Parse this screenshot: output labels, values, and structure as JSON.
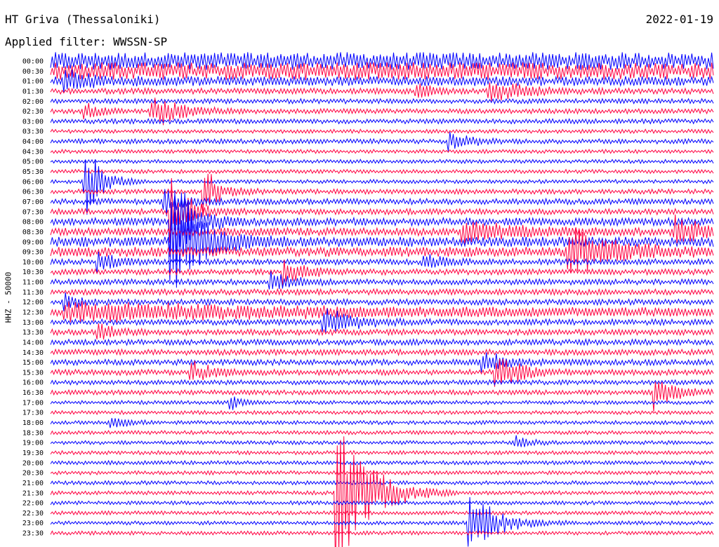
{
  "header": {
    "station": "HT Griva (Thessaloniki)",
    "date": "2022-01-19",
    "filter": "Applied filter: WWSSN-SP"
  },
  "chart_data": {
    "type": "line",
    "title": "HT Griva (Thessaloniki)",
    "ylabel": "HHZ - 50000",
    "row_labels": [
      "00:00",
      "00:30",
      "01:00",
      "01:30",
      "02:00",
      "02:30",
      "03:00",
      "03:30",
      "04:00",
      "04:30",
      "05:00",
      "05:30",
      "06:00",
      "06:30",
      "07:00",
      "07:30",
      "08:00",
      "08:30",
      "09:00",
      "09:30",
      "10:00",
      "10:30",
      "11:00",
      "11:30",
      "12:00",
      "12:30",
      "13:00",
      "13:30",
      "14:00",
      "14:30",
      "15:00",
      "15:30",
      "16:00",
      "16:30",
      "17:00",
      "17:30",
      "18:00",
      "18:30",
      "19:00",
      "19:30",
      "20:00",
      "20:30",
      "21:00",
      "21:30",
      "22:00",
      "22:30",
      "23:00",
      "23:30"
    ],
    "row_colors": [
      "#0000ff",
      "#ff0040"
    ],
    "baseline_noise": [
      9,
      9,
      5,
      3,
      2.5,
      2.5,
      2.5,
      2,
      2.5,
      2,
      2,
      2,
      2,
      2.5,
      3,
      3,
      4,
      4,
      5,
      5,
      3,
      3,
      3,
      3,
      3,
      4,
      3,
      3,
      3,
      3,
      3,
      3,
      2.5,
      2.5,
      2,
      2,
      2,
      2,
      2,
      2,
      2,
      2,
      2,
      2,
      2,
      2,
      2,
      2
    ],
    "events": [
      {
        "row": 2,
        "x": 0.02,
        "amp": 14,
        "dur": 0.04
      },
      {
        "row": 3,
        "x": 0.55,
        "amp": 12,
        "dur": 0.03
      },
      {
        "row": 3,
        "x": 0.66,
        "amp": 14,
        "dur": 0.06
      },
      {
        "row": 5,
        "x": 0.15,
        "amp": 22,
        "dur": 0.05
      },
      {
        "row": 5,
        "x": 0.05,
        "amp": 10,
        "dur": 0.03
      },
      {
        "row": 8,
        "x": 0.6,
        "amp": 10,
        "dur": 0.04
      },
      {
        "row": 12,
        "x": 0.05,
        "amp": 50,
        "dur": 0.03
      },
      {
        "row": 13,
        "x": 0.23,
        "amp": 30,
        "dur": 0.03
      },
      {
        "row": 14,
        "x": 0.17,
        "amp": 20,
        "dur": 0.03
      },
      {
        "row": 15,
        "x": 0.18,
        "amp": 40,
        "dur": 0.04
      },
      {
        "row": 16,
        "x": 0.18,
        "amp": 60,
        "dur": 0.04
      },
      {
        "row": 17,
        "x": 0.94,
        "amp": 20,
        "dur": 0.05
      },
      {
        "row": 17,
        "x": 0.62,
        "amp": 12,
        "dur": 0.1
      },
      {
        "row": 18,
        "x": 0.18,
        "amp": 60,
        "dur": 0.06
      },
      {
        "row": 19,
        "x": 0.78,
        "amp": 30,
        "dur": 0.08
      },
      {
        "row": 20,
        "x": 0.07,
        "amp": 14,
        "dur": 0.03
      },
      {
        "row": 20,
        "x": 0.56,
        "amp": 10,
        "dur": 0.04
      },
      {
        "row": 21,
        "x": 0.35,
        "amp": 14,
        "dur": 0.04
      },
      {
        "row": 22,
        "x": 0.33,
        "amp": 12,
        "dur": 0.04
      },
      {
        "row": 24,
        "x": 0.02,
        "amp": 10,
        "dur": 0.03
      },
      {
        "row": 25,
        "x": 0.02,
        "amp": 10,
        "dur": 0.5
      },
      {
        "row": 26,
        "x": 0.41,
        "amp": 16,
        "dur": 0.06
      },
      {
        "row": 27,
        "x": 0.07,
        "amp": 12,
        "dur": 0.03
      },
      {
        "row": 30,
        "x": 0.65,
        "amp": 14,
        "dur": 0.04
      },
      {
        "row": 31,
        "x": 0.21,
        "amp": 14,
        "dur": 0.04
      },
      {
        "row": 31,
        "x": 0.67,
        "amp": 26,
        "dur": 0.04
      },
      {
        "row": 33,
        "x": 0.91,
        "amp": 20,
        "dur": 0.04
      },
      {
        "row": 34,
        "x": 0.27,
        "amp": 10,
        "dur": 0.02
      },
      {
        "row": 36,
        "x": 0.09,
        "amp": 8,
        "dur": 0.03
      },
      {
        "row": 38,
        "x": 0.7,
        "amp": 8,
        "dur": 0.03
      },
      {
        "row": 43,
        "x": 0.43,
        "amp": 90,
        "dur": 0.06
      },
      {
        "row": 46,
        "x": 0.63,
        "amp": 40,
        "dur": 0.05
      }
    ]
  }
}
